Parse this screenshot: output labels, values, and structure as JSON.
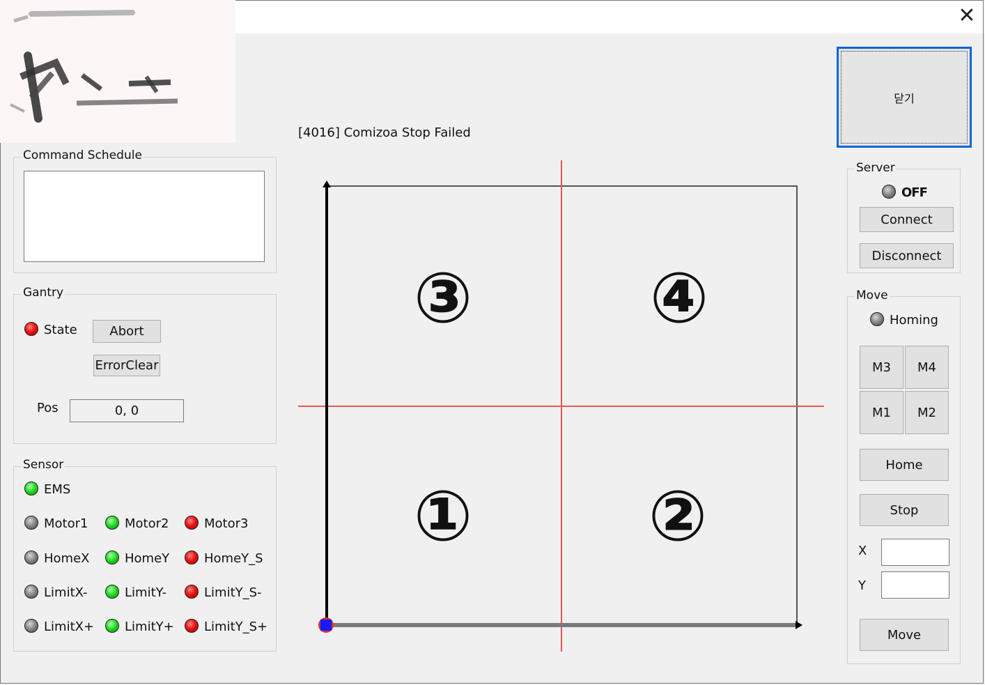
{
  "window": {
    "close_glyph": "✕"
  },
  "header": {
    "status_message": "[4016] Comizoa Stop Failed"
  },
  "close_button": {
    "label": "닫기"
  },
  "command_schedule": {
    "title": "Command Schedule"
  },
  "gantry": {
    "title": "Gantry",
    "state_label": "State",
    "state_led": "red",
    "abort_label": "Abort",
    "error_clear_label": "ErrorClear",
    "pos_label": "Pos",
    "pos_value": "0, 0"
  },
  "sensor": {
    "title": "Sensor",
    "ems": {
      "label": "EMS",
      "led": "green"
    },
    "rows": [
      [
        {
          "label": "Motor1",
          "led": "gray"
        },
        {
          "label": "Motor2",
          "led": "green"
        },
        {
          "label": "Motor3",
          "led": "red"
        }
      ],
      [
        {
          "label": "HomeX",
          "led": "gray"
        },
        {
          "label": "HomeY",
          "led": "green"
        },
        {
          "label": "HomeY_S",
          "led": "red"
        }
      ],
      [
        {
          "label": "LimitX-",
          "led": "gray"
        },
        {
          "label": "LimitY-",
          "led": "green"
        },
        {
          "label": "LimitY_S-",
          "led": "red"
        }
      ],
      [
        {
          "label": "LimitX+",
          "led": "gray"
        },
        {
          "label": "LimitY+",
          "led": "green"
        },
        {
          "label": "LimitY_S+",
          "led": "red"
        }
      ]
    ]
  },
  "server": {
    "title": "Server",
    "status_label": "OFF",
    "status_led": "gray",
    "connect_label": "Connect",
    "disconnect_label": "Disconnect"
  },
  "move": {
    "title": "Move",
    "homing_label": "Homing",
    "homing_led": "gray",
    "m3_label": "M3",
    "m4_label": "M4",
    "m1_label": "M1",
    "m2_label": "M2",
    "home_label": "Home",
    "stop_label": "Stop",
    "x_label": "X",
    "y_label": "Y",
    "x_value": "",
    "y_value": "",
    "move_label": "Move"
  },
  "plot": {
    "quadrant_1": "①",
    "quadrant_2": "②",
    "quadrant_3": "③",
    "quadrant_4": "④",
    "grid_color": "#e05555",
    "origin_color": "#1a1aff"
  }
}
